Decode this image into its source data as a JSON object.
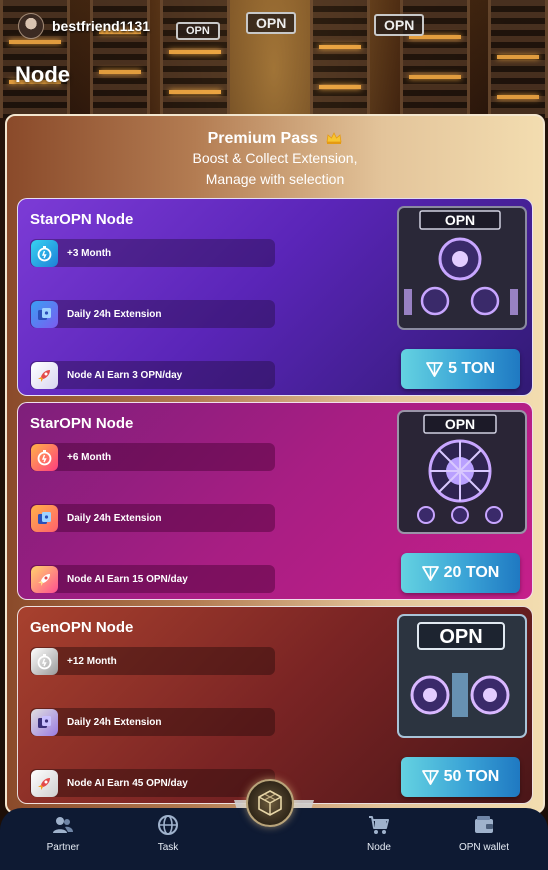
{
  "header": {
    "username": "bestfriend1131",
    "page_title": "Node"
  },
  "background": {
    "signs": [
      "OPN",
      "OPN",
      "OPN"
    ]
  },
  "premium_pass": {
    "title": "Premium Pass",
    "subtitle_line1": "Boost & Collect Extension,",
    "subtitle_line2": "Manage with selection"
  },
  "cards": [
    {
      "title": "StarOPN Node",
      "features": [
        "+3 Month",
        "Daily 24h Extension",
        "Node AI Earn 3 OPN/day"
      ],
      "price": "5 TON",
      "box_label": "OPN"
    },
    {
      "title": "StarOPN Node",
      "features": [
        "+6 Month",
        "Daily 24h Extension",
        "Node AI Earn 15 OPN/day"
      ],
      "price": "20 TON",
      "box_label": "OPN"
    },
    {
      "title": "GenOPN Node",
      "features": [
        "+12 Month",
        "Daily 24h Extension",
        "Node AI Earn 45 OPN/day"
      ],
      "price": "50 TON",
      "box_label": "OPN"
    }
  ],
  "nav": {
    "items": [
      "Partner",
      "Task",
      "Node",
      "OPN wallet"
    ]
  },
  "icons": {
    "feature": [
      "stopwatch-icon",
      "extension-icon",
      "rocket-icon"
    ],
    "currency": "ton-diamond-icon",
    "nav": [
      "partner-icon",
      "task-globe-icon",
      "cart-icon",
      "wallet-icon"
    ],
    "center": "cube-logo-icon"
  },
  "colors": {
    "panel_gradient": [
      "#8a4a2a",
      "#f3ddb0"
    ],
    "card1": "#6a2fc8",
    "card2": "#a81e83",
    "card3": "#7a2424",
    "button": "#3aa3d6",
    "nav_bg": "#0e1a33"
  }
}
